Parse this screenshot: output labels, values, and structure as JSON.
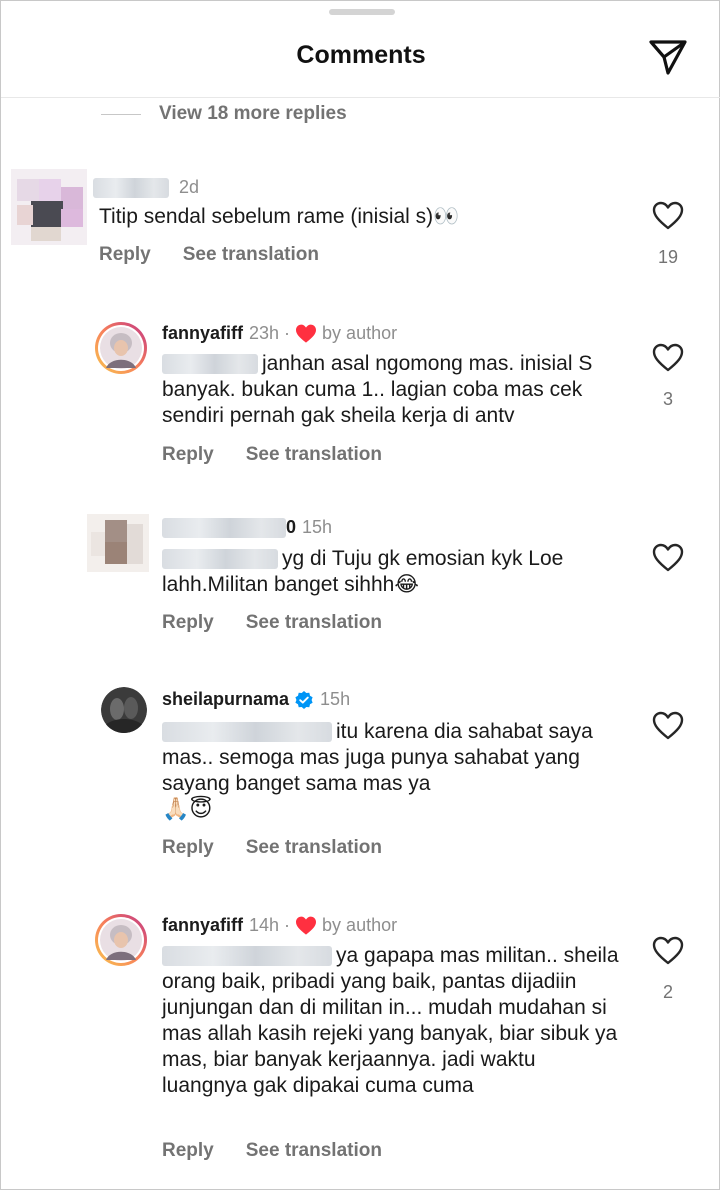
{
  "header": {
    "title": "Comments"
  },
  "thread": {
    "view_replies_label": "View 18 more replies"
  },
  "actions": {
    "reply": "Reply",
    "see_translation": "See translation"
  },
  "comments": [
    {
      "username": "",
      "time": "2d",
      "text": "Titip sendal sebelum rame (inisial s)👀",
      "likes": "19"
    },
    {
      "username": "fannyafiff",
      "time": "23h",
      "author_badge": "by author",
      "text": "janhan asal ngomong mas. inisial",
      "text_cont": "S banyak. bukan cuma 1.. lagian coba mas cek sendiri pernah gak sheila kerja di antv",
      "likes": "3"
    },
    {
      "username_tail": "0",
      "time": "15h",
      "text": "yg di Tuju gk emosian kyk Loe",
      "text_cont": "lahh.Militan banget sihhh😂",
      "likes": ""
    },
    {
      "username": "sheilapurnama",
      "time": "15h",
      "text": "itu karena dia sahabat",
      "text_cont": "saya mas.. semoga mas juga punya sahabat yang sayang banget sama mas ya",
      "emoji_line": "🙏🏻😇",
      "likes": ""
    },
    {
      "username": "fannyafiff",
      "time": "14h",
      "author_badge": "by author",
      "text": "ya gapapa mas militan..",
      "text_cont": "sheila orang baik, pribadi yang baik, pantas dijadiin junjungan dan di militan in... mudah mudahan si mas allah kasih rejeki yang banyak, biar sibuk ya mas, biar banyak kerjaannya. jadi waktu luangnya gak dipakai cuma cuma",
      "likes": "2"
    }
  ],
  "colors": {
    "secondary_text": "#737373",
    "heart_red": "#ff3040",
    "verified_blue": "#0095f6"
  },
  "icons": [
    "send-icon",
    "heart-outline-icon",
    "heart-filled-icon",
    "verified-badge-icon"
  ]
}
